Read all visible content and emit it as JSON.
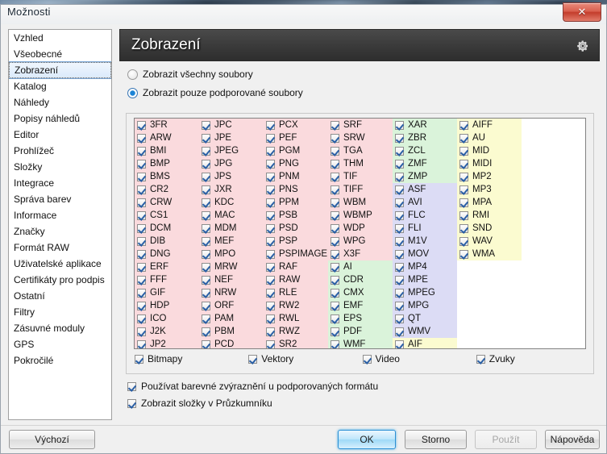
{
  "window": {
    "title": "Možnosti",
    "close_label": "✕"
  },
  "sidebar": {
    "items": [
      {
        "label": "Vzhled",
        "selected": false
      },
      {
        "label": "Všeobecné",
        "selected": false
      },
      {
        "label": "Zobrazení",
        "selected": true
      },
      {
        "label": "Katalog",
        "selected": false
      },
      {
        "label": "Náhledy",
        "selected": false
      },
      {
        "label": "Popisy náhledů",
        "selected": false
      },
      {
        "label": "Editor",
        "selected": false
      },
      {
        "label": "Prohlížeč",
        "selected": false
      },
      {
        "label": "Složky",
        "selected": false
      },
      {
        "label": "Integrace",
        "selected": false
      },
      {
        "label": "Správa barev",
        "selected": false
      },
      {
        "label": "Informace",
        "selected": false
      },
      {
        "label": "Značky",
        "selected": false
      },
      {
        "label": "Formát RAW",
        "selected": false
      },
      {
        "label": "Uživatelské aplikace",
        "selected": false
      },
      {
        "label": "Certifikáty pro podpis",
        "selected": false
      },
      {
        "label": "Ostatní",
        "selected": false
      },
      {
        "label": "Filtry",
        "selected": false
      },
      {
        "label": "Zásuvné moduly",
        "selected": false
      },
      {
        "label": "GPS",
        "selected": false
      },
      {
        "label": "Pokročilé",
        "selected": false
      }
    ]
  },
  "panel": {
    "header_title": "Zobrazení",
    "gear_icon": "gear-icon",
    "radios": [
      {
        "label": "Zobrazit všechny soubory",
        "checked": false
      },
      {
        "label": "Zobrazit pouze podporované soubory",
        "checked": true
      }
    ],
    "format_columns": [
      [
        "3FR",
        "ARW",
        "BMI",
        "BMP",
        "BMS",
        "CR2",
        "CRW",
        "CS1",
        "DCM",
        "DIB",
        "DNG",
        "ERF",
        "FFF",
        "GIF",
        "HDP",
        "ICO",
        "J2K",
        "JP2"
      ],
      [
        "JPC",
        "JPE",
        "JPEG",
        "JPG",
        "JPS",
        "JXR",
        "KDC",
        "MAC",
        "MDM",
        "MEF",
        "MPO",
        "MRW",
        "NEF",
        "NRW",
        "ORF",
        "PAM",
        "PBM",
        "PCD"
      ],
      [
        "PCX",
        "PEF",
        "PGM",
        "PNG",
        "PNM",
        "PNS",
        "PPM",
        "PSB",
        "PSD",
        "PSP",
        "PSPIMAGE",
        "RAF",
        "RAW",
        "RLE",
        "RW2",
        "RWL",
        "RWZ",
        "SR2"
      ],
      [
        "SRF",
        "SRW",
        "TGA",
        "THM",
        "TIF",
        "TIFF",
        "WBM",
        "WBMP",
        "WDP",
        "WPG",
        "X3F",
        "AI",
        "CDR",
        "CMX",
        "EMF",
        "EPS",
        "PDF",
        "WMF"
      ],
      [
        "XAR",
        "ZBR",
        "ZCL",
        "ZMF",
        "ZMP",
        "ASF",
        "AVI",
        "FLC",
        "FLI",
        "M1V",
        "MOV",
        "MP4",
        "MPE",
        "MPEG",
        "MPG",
        "QT",
        "WMV",
        "AIF"
      ],
      [
        "AIFF",
        "AU",
        "MID",
        "MIDI",
        "MP2",
        "MP3",
        "MPA",
        "RMI",
        "SND",
        "WAV",
        "WMA"
      ]
    ],
    "format_kinds": [
      [
        "bitmap",
        "bitmap",
        "bitmap",
        "bitmap",
        "bitmap",
        "bitmap",
        "bitmap",
        "bitmap",
        "bitmap",
        "bitmap",
        "bitmap",
        "bitmap",
        "bitmap",
        "bitmap",
        "bitmap",
        "bitmap",
        "bitmap",
        "bitmap"
      ],
      [
        "bitmap",
        "bitmap",
        "bitmap",
        "bitmap",
        "bitmap",
        "bitmap",
        "bitmap",
        "bitmap",
        "bitmap",
        "bitmap",
        "bitmap",
        "bitmap",
        "bitmap",
        "bitmap",
        "bitmap",
        "bitmap",
        "bitmap",
        "bitmap"
      ],
      [
        "bitmap",
        "bitmap",
        "bitmap",
        "bitmap",
        "bitmap",
        "bitmap",
        "bitmap",
        "bitmap",
        "bitmap",
        "bitmap",
        "bitmap",
        "bitmap",
        "bitmap",
        "bitmap",
        "bitmap",
        "bitmap",
        "bitmap",
        "bitmap"
      ],
      [
        "bitmap",
        "bitmap",
        "bitmap",
        "bitmap",
        "bitmap",
        "bitmap",
        "bitmap",
        "bitmap",
        "bitmap",
        "bitmap",
        "bitmap",
        "vector",
        "vector",
        "vector",
        "vector",
        "vector",
        "vector",
        "vector"
      ],
      [
        "vector",
        "vector",
        "vector",
        "vector",
        "vector",
        "video",
        "video",
        "video",
        "video",
        "video",
        "video",
        "video",
        "video",
        "video",
        "video",
        "video",
        "video",
        "audio"
      ],
      [
        "audio",
        "audio",
        "audio",
        "audio",
        "audio",
        "audio",
        "audio",
        "audio",
        "audio",
        "audio",
        "audio"
      ]
    ],
    "kind_checkboxes": [
      {
        "label": "Bitmapy",
        "checked": true
      },
      {
        "label": "Vektory",
        "checked": true
      },
      {
        "label": "Video",
        "checked": true
      },
      {
        "label": "Zvuky",
        "checked": true
      }
    ],
    "options": [
      {
        "label": "Používat barevné zvýraznění u podporovaných formátu",
        "checked": true
      },
      {
        "label": "Zobrazit složky v Průzkumníku",
        "checked": true
      }
    ]
  },
  "buttons": {
    "defaults": "Výchozí",
    "ok": "OK",
    "cancel": "Storno",
    "apply": "Použít",
    "help": "Nápověda"
  },
  "colors": {
    "bitmap": "#fadadd",
    "vector": "#daf3da",
    "video": "#dcdcf5",
    "audio": "#fbfbd0",
    "accent": "#2c8fd4",
    "header_bg": "#3b3b3b"
  }
}
